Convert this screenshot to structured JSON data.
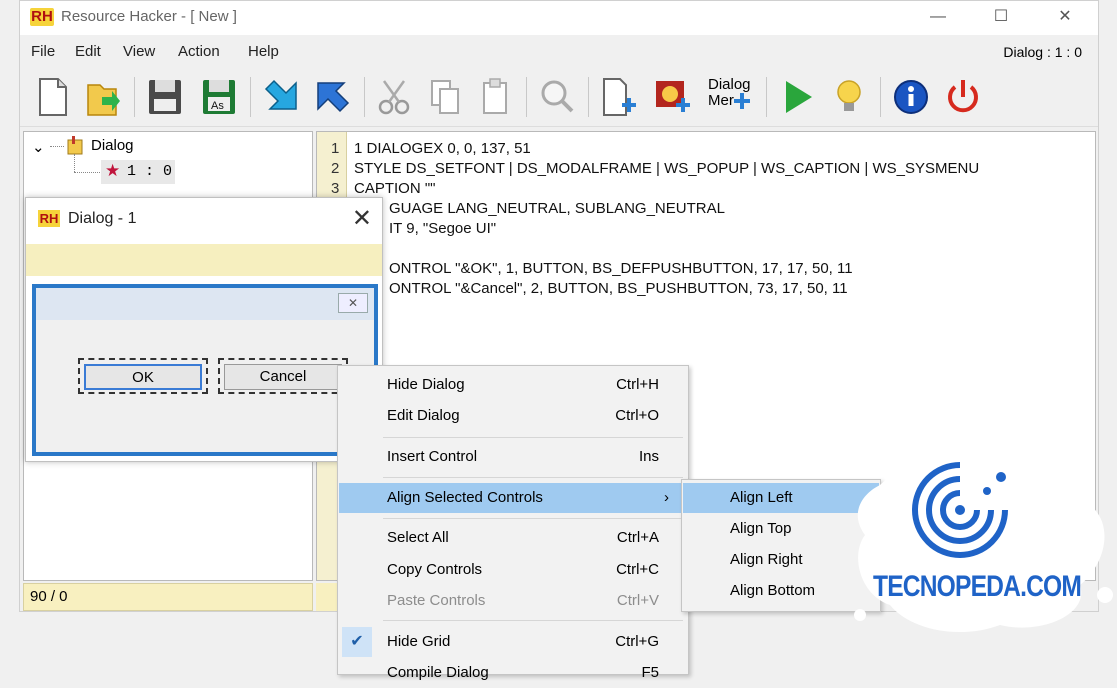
{
  "window": {
    "logo": "RH",
    "title": "Resource Hacker - [ New ]",
    "controls": [
      "—",
      "☐",
      "✕"
    ]
  },
  "menubar": {
    "items": [
      "File",
      "Edit",
      "View",
      "Action",
      "Help"
    ],
    "status_right": "Dialog : 1 : 0"
  },
  "toolbar": {
    "dialog_merge_label_line1": "Dialog",
    "dialog_merge_label_line2": "Mer"
  },
  "tree": {
    "root": "Dialog",
    "leaf": "1 : 0"
  },
  "editor": {
    "line_numbers": [
      "1",
      "2",
      "3"
    ],
    "lines": [
      "1 DIALOGEX 0, 0, 137, 51",
      "STYLE DS_SETFONT | DS_MODALFRAME | WS_POPUP | WS_CAPTION | WS_SYSMENU",
      "CAPTION \"\"",
      "GUAGE LANG_NEUTRAL, SUBLANG_NEUTRAL",
      "IT 9, \"Segoe UI\"",
      "",
      "ONTROL \"&OK\", 1, BUTTON, BS_DEFPUSHBUTTON, 17, 17, 50, 11",
      "ONTROL \"&Cancel\", 2, BUTTON, BS_PUSHBUTTON, 73, 17, 50, 11"
    ]
  },
  "statusbar": {
    "left": "90 / 0"
  },
  "preview": {
    "logo": "RH",
    "title": "Dialog - 1",
    "close": "✕",
    "dialog_close": "✕",
    "ok": "OK",
    "cancel": "Cancel"
  },
  "context_menu": {
    "items": [
      {
        "label": "Hide Dialog",
        "accel": "Ctrl+H"
      },
      {
        "label": "Edit Dialog",
        "accel": "Ctrl+O"
      },
      {
        "label": "Insert Control",
        "accel": "Ins"
      },
      {
        "label": "Align Selected Controls",
        "accel": "›"
      },
      {
        "label": "Select All",
        "accel": "Ctrl+A"
      },
      {
        "label": "Copy Controls",
        "accel": "Ctrl+C"
      },
      {
        "label": "Paste Controls",
        "accel": "Ctrl+V"
      },
      {
        "label": "Hide Grid",
        "accel": "Ctrl+G"
      },
      {
        "label": "Compile Dialog",
        "accel": "F5"
      }
    ],
    "highlight_color": "#9fcaf0"
  },
  "submenu": {
    "items": [
      "Align Left",
      "Align Top",
      "Align Right",
      "Align Bottom"
    ]
  },
  "watermark": {
    "text": "TECNOPEDA.COM",
    "color": "#1f63c7"
  }
}
